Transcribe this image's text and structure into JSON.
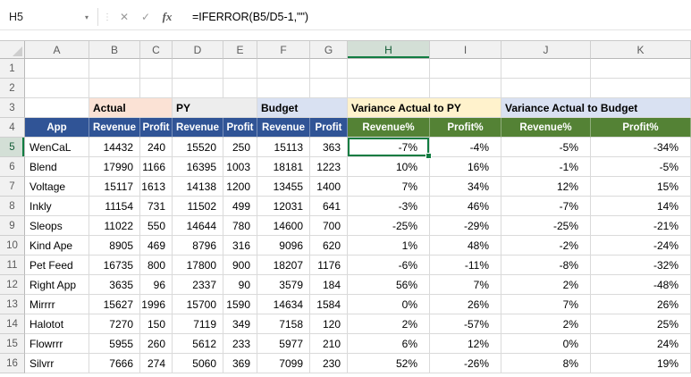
{
  "formula_bar": {
    "name_box": "H5",
    "dropdown_glyph": "▾",
    "grip_glyph": "⋮",
    "cancel_glyph": "✕",
    "enter_glyph": "✓",
    "fx_glyph": "fx",
    "formula": "=IFERROR(B5/D5-1,\"\")"
  },
  "colors": {
    "header_blue": "#305496",
    "header_green": "#548235",
    "band_actual": "#FBE2D5",
    "band_py": "#EDEDED",
    "band_budget": "#D9E1F2",
    "band_variance_py": "#FFF2CC",
    "band_variance_budget": "#D9E1F2",
    "selection_green": "#107C41"
  },
  "sheet": {
    "column_headers": [
      "A",
      "B",
      "C",
      "D",
      "E",
      "F",
      "G",
      "H",
      "I",
      "J",
      "K"
    ],
    "row_numbers": [
      1,
      2,
      3,
      4,
      5,
      6,
      7,
      8,
      9,
      10,
      11,
      12,
      13,
      14,
      15,
      16
    ],
    "active_cell": "H5",
    "active_column": "H",
    "active_row": 5,
    "bands": [
      {
        "key": "actual",
        "label": "Actual",
        "span": 2,
        "color_key": "band_actual"
      },
      {
        "key": "py",
        "label": "PY",
        "span": 2,
        "color_key": "band_py"
      },
      {
        "key": "budget",
        "label": "Budget",
        "span": 2,
        "color_key": "band_budget"
      },
      {
        "key": "variance-py",
        "label": "Variance Actual to PY",
        "span": 2,
        "color_key": "band_variance_py"
      },
      {
        "key": "variance-budget",
        "label": "Variance Actual to Budget",
        "span": 2,
        "color_key": "band_variance_budget"
      }
    ],
    "table_header": {
      "app": "App",
      "cols": [
        {
          "label": "Revenue",
          "theme": "blue"
        },
        {
          "label": "Profit",
          "theme": "blue"
        },
        {
          "label": "Revenue",
          "theme": "blue"
        },
        {
          "label": "Profit",
          "theme": "blue"
        },
        {
          "label": "Revenue",
          "theme": "blue"
        },
        {
          "label": "Profit",
          "theme": "blue"
        },
        {
          "label": "Revenue%",
          "theme": "green"
        },
        {
          "label": "Profit%",
          "theme": "green"
        },
        {
          "label": "Revenue%",
          "theme": "green"
        },
        {
          "label": "Profit%",
          "theme": "green"
        }
      ]
    },
    "rows": [
      {
        "row": 5,
        "app": "WenCaL",
        "values": [
          "14432",
          "240",
          "15520",
          "250",
          "15113",
          "363",
          "-7%",
          "-4%",
          "-5%",
          "-34%"
        ]
      },
      {
        "row": 6,
        "app": "Blend",
        "values": [
          "17990",
          "1166",
          "16395",
          "1003",
          "18181",
          "1223",
          "10%",
          "16%",
          "-1%",
          "-5%"
        ]
      },
      {
        "row": 7,
        "app": "Voltage",
        "values": [
          "15117",
          "1613",
          "14138",
          "1200",
          "13455",
          "1400",
          "7%",
          "34%",
          "12%",
          "15%"
        ]
      },
      {
        "row": 8,
        "app": "Inkly",
        "values": [
          "11154",
          "731",
          "11502",
          "499",
          "12031",
          "641",
          "-3%",
          "46%",
          "-7%",
          "14%"
        ]
      },
      {
        "row": 9,
        "app": "Sleops",
        "values": [
          "11022",
          "550",
          "14644",
          "780",
          "14600",
          "700",
          "-25%",
          "-29%",
          "-25%",
          "-21%"
        ]
      },
      {
        "row": 10,
        "app": "Kind Ape",
        "values": [
          "8905",
          "469",
          "8796",
          "316",
          "9096",
          "620",
          "1%",
          "48%",
          "-2%",
          "-24%"
        ]
      },
      {
        "row": 11,
        "app": "Pet Feed",
        "values": [
          "16735",
          "800",
          "17800",
          "900",
          "18207",
          "1176",
          "-6%",
          "-11%",
          "-8%",
          "-32%"
        ]
      },
      {
        "row": 12,
        "app": "Right App",
        "values": [
          "3635",
          "96",
          "2337",
          "90",
          "3579",
          "184",
          "56%",
          "7%",
          "2%",
          "-48%"
        ]
      },
      {
        "row": 13,
        "app": "Mirrrr",
        "values": [
          "15627",
          "1996",
          "15700",
          "1590",
          "14634",
          "1584",
          "0%",
          "26%",
          "7%",
          "26%"
        ]
      },
      {
        "row": 14,
        "app": "Halotot",
        "values": [
          "7270",
          "150",
          "7119",
          "349",
          "7158",
          "120",
          "2%",
          "-57%",
          "2%",
          "25%"
        ]
      },
      {
        "row": 15,
        "app": "Flowrrr",
        "values": [
          "5955",
          "260",
          "5612",
          "233",
          "5977",
          "210",
          "6%",
          "12%",
          "0%",
          "24%"
        ]
      },
      {
        "row": 16,
        "app": "Silvrr",
        "values": [
          "7666",
          "274",
          "5060",
          "369",
          "7099",
          "230",
          "52%",
          "-26%",
          "8%",
          "19%"
        ]
      }
    ]
  }
}
